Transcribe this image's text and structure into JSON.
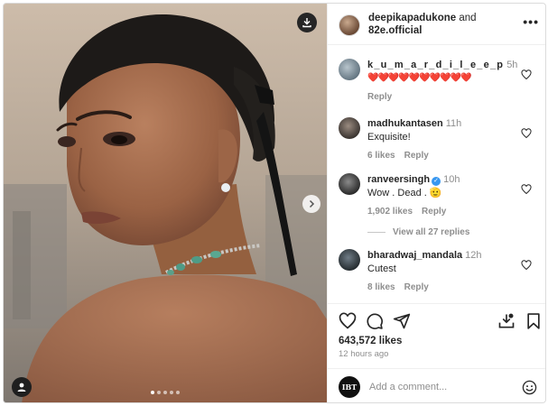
{
  "post": {
    "author": "deepikapadukone",
    "joiner": " and",
    "collaborator": "82e.official",
    "more_label": "•••",
    "image_count": 5,
    "active_index": 1
  },
  "comments": [
    {
      "user": "k_u_m_a_r_d_i_l_e_e_p",
      "time": "5h",
      "text": "❤️❤️❤️❤️❤️❤️❤️❤️❤️❤️",
      "likes": "",
      "reply": "Reply",
      "verified": false
    },
    {
      "user": "madhukantasen",
      "time": "11h",
      "text": "Exquisite!",
      "likes": "6 likes",
      "reply": "Reply",
      "verified": false
    },
    {
      "user": "ranveersingh",
      "time": "10h",
      "text": "Wow . Dead . 🫡",
      "likes": "1,902 likes",
      "reply": "Reply",
      "verified": true
    },
    {
      "user": "bharadwaj_mandala",
      "time": "12h",
      "text": "Cutest",
      "likes": "8 likes",
      "reply": "Reply",
      "verified": false
    }
  ],
  "view_replies": "View all 27 replies",
  "verified_mark": "✓",
  "actions": {
    "likes_count": "643,572 likes",
    "time_ago": "12 hours ago"
  },
  "composer": {
    "avatar_text": "IBT",
    "placeholder": "Add a comment..."
  },
  "icons": {
    "download": "download-icon",
    "next": "chevron-right-icon",
    "user_tag": "person-icon",
    "like": "heart-icon",
    "comment": "comment-icon",
    "share": "send-icon",
    "save": "bookmark-icon",
    "emoji": "smiley-icon"
  }
}
